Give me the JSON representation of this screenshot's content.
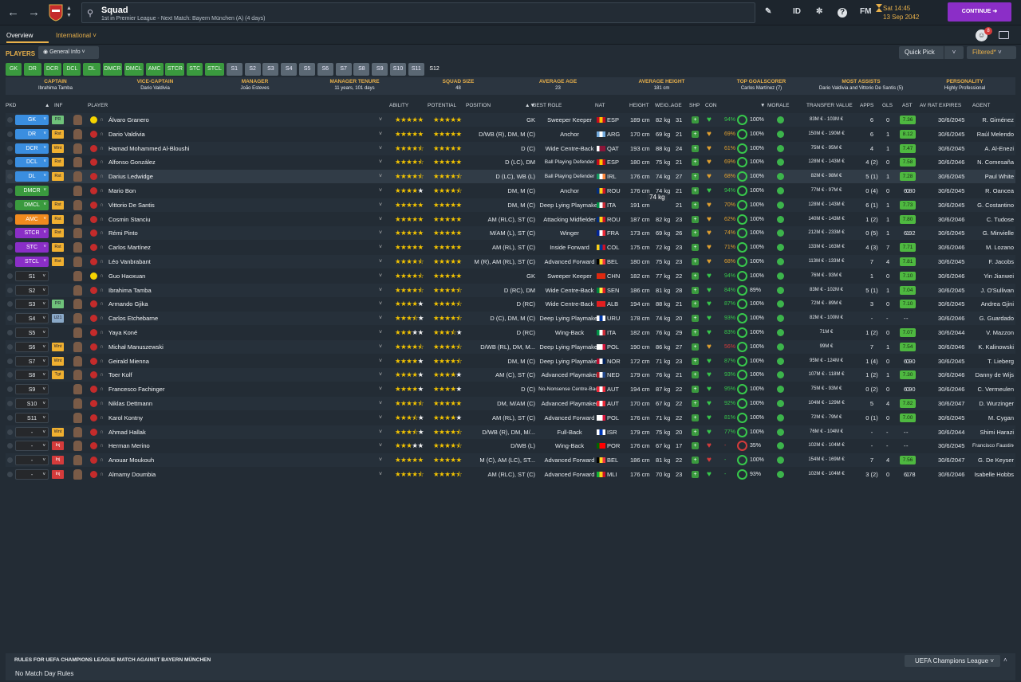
{
  "header": {
    "title": "Squad",
    "subtitle": "1st in Premier League - Next Match: Bayern München (A) (4 days)",
    "id_label": "ID",
    "fm_label": "FM",
    "time": "Sat 14:45",
    "date": "13 Sep 2042",
    "continue_label": "CONTINUE",
    "notification_count": "8"
  },
  "subnav": {
    "overview": "Overview",
    "international": "International"
  },
  "toolbar": {
    "players_label": "PLAYERS",
    "view": "General Info",
    "quick_pick": "Quick Pick",
    "filter": "Filtered*"
  },
  "chips": [
    {
      "label": "GK",
      "c": "g"
    },
    {
      "label": "DR",
      "c": "g"
    },
    {
      "label": "DCR",
      "c": "g"
    },
    {
      "label": "DCL",
      "c": "g"
    },
    {
      "label": "DL",
      "c": "g"
    },
    {
      "label": "DMCR",
      "c": "g"
    },
    {
      "label": "DMCL",
      "c": "g"
    },
    {
      "label": "AMC",
      "c": "g"
    },
    {
      "label": "STCR",
      "c": "g"
    },
    {
      "label": "STC",
      "c": "g"
    },
    {
      "label": "STCL",
      "c": "g"
    },
    {
      "label": "S1",
      "c": "s"
    },
    {
      "label": "S2",
      "c": "s"
    },
    {
      "label": "S3",
      "c": "s"
    },
    {
      "label": "S4",
      "c": "s"
    },
    {
      "label": "S5",
      "c": "s"
    },
    {
      "label": "S6",
      "c": "s"
    },
    {
      "label": "S7",
      "c": "s"
    },
    {
      "label": "S8",
      "c": "s"
    },
    {
      "label": "S9",
      "c": "s"
    },
    {
      "label": "S10",
      "c": "s"
    },
    {
      "label": "S11",
      "c": "s"
    },
    {
      "label": "S12",
      "c": "sel"
    }
  ],
  "stats": [
    {
      "h": "CAPTAIN",
      "v": "Ibrahima Tamba"
    },
    {
      "h": "VICE-CAPTAIN",
      "v": "Dario Valdivia"
    },
    {
      "h": "MANAGER",
      "v": "João Esteves"
    },
    {
      "h": "MANAGER TENURE",
      "v": "11 years, 101 days"
    },
    {
      "h": "SQUAD SIZE",
      "v": "48"
    },
    {
      "h": "AVERAGE AGE",
      "v": "23"
    },
    {
      "h": "AVERAGE HEIGHT",
      "v": "181 cm"
    },
    {
      "h": "TOP GOALSCORER",
      "v": "Carlos Martínez (7)"
    },
    {
      "h": "MOST ASSISTS",
      "v": "Dario Valdivia and Vittorio De Santis (5)"
    },
    {
      "h": "PERSONALITY",
      "v": "Highly Professional"
    }
  ],
  "columns": {
    "pkd": "PKD",
    "inf": "INF",
    "player": "PLAYER",
    "ability": "ABILITY",
    "potential": "POTENTIAL",
    "position": "POSITION",
    "best_role": "BEST ROLE",
    "nat": "NAT",
    "height": "HEIGHT",
    "weight": "WEIG...",
    "age": "AGE",
    "shp": "SHP",
    "con": "CON",
    "morale": "MORALE",
    "value": "TRANSFER VALUE",
    "apps": "APPS",
    "gls": "GLS",
    "ast": "AST",
    "avrat": "AV RAT",
    "expires": "EXPIRES",
    "agent": "AGENT"
  },
  "tooltip": "74 kg",
  "players": [
    {
      "sel": "GK",
      "sc": "#3a8ee0",
      "inf": "PR",
      "ic": "#6fc27a",
      "kit": "y",
      "name": "Álvaro Granero",
      "ab": 5,
      "po": 5,
      "pos": "GK",
      "role": "Sweeper Keeper",
      "nat": "ESP",
      "f": [
        "#c60b1e",
        "#ffc400",
        "#c60b1e"
      ],
      "h": "189 cm",
      "w": "82 kg",
      "age": "31",
      "hc": "#37c74b",
      "cp": "94%",
      "cc": "#37c74b",
      "mo": "100%",
      "val": "83M € - 103M €",
      "apps": "6",
      "gls": "0",
      "ast": "0",
      "rat": "7.36",
      "exp": "30/6/2045",
      "ag": "R. Giménez"
    },
    {
      "sel": "DR",
      "sc": "#3a8ee0",
      "inf": "Rst",
      "ic": "#f0b030",
      "kit": "r",
      "name": "Dario Valdivia",
      "ab": 5,
      "po": 5,
      "pos": "D/WB (R), DM, M (C)",
      "role": "Anchor",
      "nat": "ARG",
      "f": [
        "#74acdf",
        "#fff",
        "#74acdf"
      ],
      "h": "170 cm",
      "w": "69 kg",
      "age": "21",
      "hc": "#e0a030",
      "cp": "69%",
      "cc": "#e0a030",
      "mo": "100%",
      "val": "150M € - 190M €",
      "apps": "6",
      "gls": "1",
      "ast": "5",
      "rat": "8.12",
      "exp": "30/6/2045",
      "ag": "Raúl Melendo"
    },
    {
      "sel": "DCR",
      "sc": "#3a8ee0",
      "inf": "Wnt",
      "ic": "#f0b030",
      "kit": "r",
      "name": "Hamad Mohammed Al-Bloushi",
      "ab": 4.5,
      "po": 5,
      "pos": "D (C)",
      "role": "Wide Centre-Back",
      "nat": "QAT",
      "f": [
        "#fff",
        "#8a1538",
        "#8a1538"
      ],
      "h": "193 cm",
      "w": "88 kg",
      "age": "24",
      "hc": "#e0a030",
      "cp": "61%",
      "cc": "#e0a030",
      "mo": "100%",
      "val": "75M € - 95M €",
      "apps": "4",
      "gls": "1",
      "ast": "0",
      "rat": "7.47",
      "exp": "30/6/2045",
      "ag": "A. Al-Enezi"
    },
    {
      "sel": "DCL",
      "sc": "#3a8ee0",
      "inf": "Rst",
      "ic": "#f0b030",
      "kit": "r",
      "name": "Alfonso González",
      "ab": 4.5,
      "po": 5,
      "pos": "D (LC), DM",
      "role": "Ball Playing Defender",
      "nat": "ESP",
      "f": [
        "#c60b1e",
        "#ffc400",
        "#c60b1e"
      ],
      "h": "180 cm",
      "w": "75 kg",
      "age": "21",
      "hc": "#e0a030",
      "cp": "69%",
      "cc": "#e0a030",
      "mo": "100%",
      "val": "128M € - 143M €",
      "apps": "4 (2)",
      "gls": "0",
      "ast": "2",
      "rat": "7.58",
      "exp": "30/6/2046",
      "ag": "N. Comesaña"
    },
    {
      "sel": "DL",
      "sc": "#3a8ee0",
      "inf": "Rst",
      "ic": "#f0b030",
      "kit": "r",
      "name": "Darius Ledwidge",
      "ab": 4.5,
      "po": 4.5,
      "pos": "D (LC), WB (L)",
      "role": "Ball Playing Defender",
      "nat": "IRL",
      "f": [
        "#169b62",
        "#fff",
        "#ff883e"
      ],
      "h": "176 cm",
      "w": "74 kg",
      "age": "27",
      "hc": "#e0a030",
      "cp": "68%",
      "cc": "#e0a030",
      "mo": "100%",
      "val": "82M € - 98M €",
      "apps": "5 (1)",
      "gls": "1",
      "ast": "1",
      "rat": "7.28",
      "exp": "30/6/2045",
      "ag": "Paul White",
      "hl": true
    },
    {
      "sel": "DMCR",
      "sc": "#3a9a3e",
      "inf": "",
      "ic": "",
      "kit": "r",
      "name": "Mario Bon",
      "ab": 4,
      "po": 4.5,
      "pos": "DM, M (C)",
      "role": "Anchor",
      "nat": "ROU",
      "f": [
        "#002b7f",
        "#fcd116",
        "#ce1126"
      ],
      "h": "176 cm",
      "w": "74 kg",
      "age": "21",
      "hc": "#37c74b",
      "cp": "94%",
      "cc": "#37c74b",
      "mo": "100%",
      "val": "77M € - 97M €",
      "apps": "0 (4)",
      "gls": "0",
      "ast": "0",
      "rat": "6.80",
      "exp": "30/6/2045",
      "ag": "R. Oancea"
    },
    {
      "sel": "DMCL",
      "sc": "#3a9a3e",
      "inf": "Rst",
      "ic": "#f0b030",
      "kit": "r",
      "name": "Vittorio De Santis",
      "ab": 5,
      "po": 5,
      "pos": "DM, M (C)",
      "role": "Deep Lying Playmaker",
      "nat": "ITA",
      "f": [
        "#009246",
        "#fff",
        "#ce2b37"
      ],
      "h": "191 cm",
      "w": "",
      "age": "21",
      "hc": "#e0a030",
      "cp": "70%",
      "cc": "#e0a030",
      "mo": "100%",
      "val": "128M € - 143M €",
      "apps": "6 (1)",
      "gls": "1",
      "ast": "5",
      "rat": "7.73",
      "exp": "30/6/2045",
      "ag": "G. Costantino"
    },
    {
      "sel": "AMC",
      "sc": "#f08a1e",
      "inf": "Rst",
      "ic": "#f0b030",
      "kit": "r",
      "name": "Cosmin Stanciu",
      "ab": 5,
      "po": 5,
      "pos": "AM (RLC), ST (C)",
      "role": "Attacking Midfielder",
      "nat": "ROU",
      "f": [
        "#002b7f",
        "#fcd116",
        "#ce1126"
      ],
      "h": "187 cm",
      "w": "82 kg",
      "age": "23",
      "hc": "#e0a030",
      "cp": "62%",
      "cc": "#e0a030",
      "mo": "100%",
      "val": "140M € - 143M €",
      "apps": "1 (2)",
      "gls": "1",
      "ast": "1",
      "rat": "7.80",
      "exp": "30/6/2046",
      "ag": "C. Tudose"
    },
    {
      "sel": "STCR",
      "sc": "#8a2ec7",
      "inf": "Rst",
      "ic": "#f0b030",
      "kit": "r",
      "name": "Rémi Pinto",
      "ab": 5,
      "po": 5,
      "pos": "M/AM (L), ST (C)",
      "role": "Winger",
      "nat": "FRA",
      "f": [
        "#002395",
        "#fff",
        "#ed2939"
      ],
      "h": "173 cm",
      "w": "69 kg",
      "age": "26",
      "hc": "#e0a030",
      "cp": "74%",
      "cc": "#e0a030",
      "mo": "100%",
      "val": "212M € - 233M €",
      "apps": "0 (5)",
      "gls": "1",
      "ast": "1",
      "rat": "6.92",
      "exp": "30/6/2045",
      "ag": "G. Minvielle"
    },
    {
      "sel": "STC",
      "sc": "#8a2ec7",
      "inf": "Rst",
      "ic": "#f0b030",
      "kit": "r",
      "name": "Carlos Martínez",
      "ab": 5,
      "po": 5,
      "pos": "AM (RL), ST (C)",
      "role": "Inside Forward",
      "nat": "COL",
      "f": [
        "#fcd116",
        "#003893",
        "#ce1126"
      ],
      "h": "175 cm",
      "w": "72 kg",
      "age": "23",
      "hc": "#e0a030",
      "cp": "71%",
      "cc": "#e0a030",
      "mo": "100%",
      "val": "133M € - 163M €",
      "apps": "4 (3)",
      "gls": "7",
      "ast": "2",
      "rat": "7.71",
      "exp": "30/6/2046",
      "ag": "M. Lozano"
    },
    {
      "sel": "STCL",
      "sc": "#8a2ec7",
      "inf": "Rst",
      "ic": "#f0b030",
      "kit": "r",
      "name": "Léo Vanbrabant",
      "ab": 4.5,
      "po": 5,
      "pos": "M (R), AM (RL), ST (C)",
      "role": "Advanced Forward",
      "nat": "BEL",
      "f": [
        "#000",
        "#fdda24",
        "#ef3340"
      ],
      "h": "180 cm",
      "w": "75 kg",
      "age": "23",
      "hc": "#e0a030",
      "cp": "68%",
      "cc": "#e0a030",
      "mo": "100%",
      "val": "113M € - 133M €",
      "apps": "7",
      "gls": "4",
      "ast": "3",
      "rat": "7.81",
      "exp": "30/6/2045",
      "ag": "F. Jacobs"
    },
    {
      "sel": "S1",
      "sc": "",
      "inf": "",
      "ic": "",
      "kit": "y",
      "name": "Guo Haoxuan",
      "ab": 4.5,
      "po": 5,
      "pos": "GK",
      "role": "Sweeper Keeper",
      "nat": "CHN",
      "f": [
        "#de2910",
        "#de2910",
        "#de2910"
      ],
      "h": "182 cm",
      "w": "77 kg",
      "age": "22",
      "hc": "#37c74b",
      "cp": "94%",
      "cc": "#37c74b",
      "mo": "100%",
      "val": "76M € - 93M €",
      "apps": "1",
      "gls": "0",
      "ast": "0",
      "rat": "7.10",
      "exp": "30/6/2046",
      "ag": "Yin Jianwei"
    },
    {
      "sel": "S2",
      "sc": "",
      "inf": "",
      "ic": "",
      "kit": "r",
      "name": "Ibrahima Tamba",
      "ab": 4.5,
      "po": 4.5,
      "pos": "D (RC), DM",
      "role": "Wide Centre-Back",
      "nat": "SEN",
      "f": [
        "#00853f",
        "#fdef42",
        "#e31b23"
      ],
      "h": "186 cm",
      "w": "81 kg",
      "age": "28",
      "hc": "#37c74b",
      "cp": "84%",
      "cc": "#37c74b",
      "mo": "89%",
      "val": "83M € - 102M €",
      "apps": "5 (1)",
      "gls": "1",
      "ast": "0",
      "rat": "7.04",
      "exp": "30/6/2045",
      "ag": "J. O'Sullivan"
    },
    {
      "sel": "S3",
      "sc": "",
      "inf": "PR",
      "ic": "#6fc27a",
      "kit": "r",
      "name": "Armando Gjika",
      "ab": 4,
      "po": 4.5,
      "pos": "D (RC)",
      "role": "Wide Centre-Back",
      "nat": "ALB",
      "f": [
        "#e41e20",
        "#e41e20",
        "#e41e20"
      ],
      "h": "194 cm",
      "w": "88 kg",
      "age": "21",
      "hc": "#37c74b",
      "cp": "87%",
      "cc": "#37c74b",
      "mo": "100%",
      "val": "72M € - 89M €",
      "apps": "3",
      "gls": "0",
      "ast": "0",
      "rat": "7.10",
      "exp": "30/6/2045",
      "ag": "Andrea Gjini"
    },
    {
      "sel": "S4",
      "sc": "",
      "inf": "U21",
      "ic": "#8aa9c8",
      "kit": "r",
      "name": "Carlos Etchebarne",
      "ab": 3.5,
      "po": 4.5,
      "pos": "D (C), DM, M (C)",
      "role": "Deep Lying Playmaker",
      "nat": "URU",
      "f": [
        "#fff",
        "#0038a8",
        "#fff"
      ],
      "h": "178 cm",
      "w": "74 kg",
      "age": "20",
      "hc": "#37c74b",
      "cp": "93%",
      "cc": "#37c74b",
      "mo": "100%",
      "val": "82M € - 100M €",
      "apps": "-",
      "gls": "-",
      "ast": "-",
      "rat": "-",
      "exp": "30/6/2046",
      "ag": "G. Guardado"
    },
    {
      "sel": "S5",
      "sc": "",
      "inf": "",
      "ic": "",
      "kit": "r",
      "name": "Yaya Koné",
      "ab": 3,
      "po": 3.5,
      "pos": "D (RC)",
      "role": "Wing-Back",
      "nat": "ITA",
      "f": [
        "#009246",
        "#fff",
        "#ce2b37"
      ],
      "h": "182 cm",
      "w": "76 kg",
      "age": "29",
      "hc": "#37c74b",
      "cp": "83%",
      "cc": "#37c74b",
      "mo": "100%",
      "val": "71M €",
      "apps": "1 (2)",
      "gls": "0",
      "ast": "0",
      "rat": "7.07",
      "exp": "30/6/2044",
      "ag": "V. Mazzon"
    },
    {
      "sel": "S6",
      "sc": "",
      "inf": "Wnt",
      "ic": "#f0b030",
      "kit": "r",
      "name": "Michał Manuszewski",
      "ab": 4.5,
      "po": 4.5,
      "pos": "D/WB (RL), DM, M...",
      "role": "Deep Lying Playmaker",
      "nat": "POL",
      "f": [
        "#fff",
        "#fff",
        "#dc143c"
      ],
      "h": "190 cm",
      "w": "86 kg",
      "age": "27",
      "hc": "#e0a030",
      "cp": "56%",
      "cc": "#d43b3b",
      "mo": "100%",
      "val": "99M €",
      "apps": "7",
      "gls": "1",
      "ast": "3",
      "rat": "7.54",
      "exp": "30/6/2046",
      "ag": "K. Kalinowski"
    },
    {
      "sel": "S7",
      "sc": "",
      "inf": "Wnt",
      "ic": "#f0b030",
      "kit": "r",
      "name": "Geirald Mienna",
      "ab": 4,
      "po": 4.5,
      "pos": "DM, M (C)",
      "role": "Deep Lying Playmaker",
      "nat": "NOR",
      "f": [
        "#ba0c2f",
        "#fff",
        "#00205b"
      ],
      "h": "172 cm",
      "w": "71 kg",
      "age": "23",
      "hc": "#37c74b",
      "cp": "87%",
      "cc": "#37c74b",
      "mo": "100%",
      "val": "95M € - 124M €",
      "apps": "1 (4)",
      "gls": "0",
      "ast": "0",
      "rat": "6.90",
      "exp": "30/6/2045",
      "ag": "T. Lieberg"
    },
    {
      "sel": "S8",
      "sc": "",
      "inf": "Tgt",
      "ic": "#f0b030",
      "kit": "r",
      "name": "Toer Kolf",
      "ab": 4,
      "po": 4,
      "pos": "AM (C), ST (C)",
      "role": "Advanced Playmaker",
      "nat": "NED",
      "f": [
        "#ae1c28",
        "#fff",
        "#21468b"
      ],
      "h": "179 cm",
      "w": "76 kg",
      "age": "21",
      "hc": "#37c74b",
      "cp": "93%",
      "cc": "#37c74b",
      "mo": "100%",
      "val": "107M € - 118M €",
      "apps": "1 (2)",
      "gls": "1",
      "ast": "0",
      "rat": "7.30",
      "exp": "30/6/2046",
      "ag": "Danny de Wijs"
    },
    {
      "sel": "S9",
      "sc": "",
      "inf": "",
      "ic": "",
      "kit": "r",
      "name": "Francesco Fachinger",
      "ab": 4,
      "po": 4,
      "pos": "D (C)",
      "role": "No-Nonsense Centre-Back",
      "nat": "AUT",
      "f": [
        "#ed2939",
        "#fff",
        "#ed2939"
      ],
      "h": "194 cm",
      "w": "87 kg",
      "age": "22",
      "hc": "#37c74b",
      "cp": "95%",
      "cc": "#37c74b",
      "mo": "100%",
      "val": "75M € - 93M €",
      "apps": "0 (2)",
      "gls": "0",
      "ast": "0",
      "rat": "6.90",
      "exp": "30/6/2046",
      "ag": "C. Vermeulen"
    },
    {
      "sel": "S10",
      "sc": "",
      "inf": "",
      "ic": "",
      "kit": "r",
      "name": "Niklas Dettmann",
      "ab": 4.5,
      "po": 5,
      "pos": "DM, M/AM (C)",
      "role": "Advanced Playmaker",
      "nat": "AUT",
      "f": [
        "#ed2939",
        "#fff",
        "#ed2939"
      ],
      "h": "170 cm",
      "w": "67 kg",
      "age": "22",
      "hc": "#37c74b",
      "cp": "92%",
      "cc": "#37c74b",
      "mo": "100%",
      "val": "104M € - 129M €",
      "apps": "5",
      "gls": "4",
      "ast": "0",
      "rat": "7.82",
      "exp": "30/6/2047",
      "ag": "D. Wurzinger"
    },
    {
      "sel": "S11",
      "sc": "",
      "inf": "",
      "ic": "",
      "kit": "r",
      "name": "Karol Kontny",
      "ab": 3.5,
      "po": 4,
      "pos": "AM (RL), ST (C)",
      "role": "Advanced Forward",
      "nat": "POL",
      "f": [
        "#fff",
        "#fff",
        "#dc143c"
      ],
      "h": "176 cm",
      "w": "71 kg",
      "age": "22",
      "hc": "#37c74b",
      "cp": "81%",
      "cc": "#37c74b",
      "mo": "100%",
      "val": "72M € - 79M €",
      "apps": "0 (1)",
      "gls": "0",
      "ast": "0",
      "rat": "7.00",
      "exp": "30/6/2045",
      "ag": "M. Cygan"
    },
    {
      "sel": "-",
      "sc": "",
      "inf": "Wnt",
      "ic": "#f0b030",
      "kit": "r",
      "name": "Ahmad Hallak",
      "ab": 3.5,
      "po": 4.5,
      "pos": "D/WB (R), DM, M/...",
      "role": "Full-Back",
      "nat": "ISR",
      "f": [
        "#fff",
        "#0038b8",
        "#fff"
      ],
      "h": "179 cm",
      "w": "75 kg",
      "age": "20",
      "hc": "#37c74b",
      "cp": "77%",
      "cc": "#37c74b",
      "mo": "100%",
      "val": "76M € - 104M €",
      "apps": "-",
      "gls": "-",
      "ast": "-",
      "rat": "-",
      "exp": "30/6/2044",
      "ag": "Shimi Harazi"
    },
    {
      "sel": "-",
      "sc": "",
      "inf": "Inj",
      "ic": "#d43b3b",
      "kit": "r",
      "name": "Herman Merino",
      "ab": 3,
      "po": 4.5,
      "pos": "D/WB (L)",
      "role": "Wing-Back",
      "nat": "POR",
      "f": [
        "#006600",
        "#ff0000",
        "#ff0000"
      ],
      "h": "176 cm",
      "w": "67 kg",
      "age": "17",
      "hc": "#d43b3b",
      "cp": "-",
      "cc": "#d43b3b",
      "mo": "35%",
      "val": "102M € - 104M €",
      "apps": "-",
      "gls": "-",
      "ast": "-",
      "rat": "-",
      "exp": "30/6/2045",
      "ag": "Francisco Faustino"
    },
    {
      "sel": "-",
      "sc": "",
      "inf": "Inj",
      "ic": "#d43b3b",
      "kit": "r",
      "name": "Anouar Moukouh",
      "ab": 5,
      "po": 5,
      "pos": "M (C), AM (LC), ST...",
      "role": "Advanced Forward",
      "nat": "BEL",
      "f": [
        "#000",
        "#fdda24",
        "#ef3340"
      ],
      "h": "186 cm",
      "w": "81 kg",
      "age": "22",
      "hc": "#d43b3b",
      "cp": "-",
      "cc": "#37c74b",
      "mo": "100%",
      "val": "154M € - 169M €",
      "apps": "7",
      "gls": "4",
      "ast": "0",
      "rat": "7.56",
      "exp": "30/6/2047",
      "ag": "G. De Keyser"
    },
    {
      "sel": "-",
      "sc": "",
      "inf": "Inj",
      "ic": "#d43b3b",
      "kit": "r",
      "name": "Almamy Doumbia",
      "ab": 4.5,
      "po": 4.5,
      "pos": "AM (RLC), ST (C)",
      "role": "Advanced Forward",
      "nat": "MLI",
      "f": [
        "#14b53a",
        "#fcd116",
        "#ce1126"
      ],
      "h": "176 cm",
      "w": "70 kg",
      "age": "23",
      "hc": "#37c74b",
      "cp": "-",
      "cc": "#37c74b",
      "mo": "93%",
      "val": "102M € - 104M €",
      "apps": "3 (2)",
      "gls": "0",
      "ast": "1",
      "rat": "6.78",
      "exp": "30/6/2046",
      "ag": "Isabelle Hobbs"
    }
  ],
  "bottom": {
    "title": "RULES FOR UEFA CHAMPIONS LEAGUE MATCH AGAINST BAYERN MÜNCHEN",
    "value": "No Match Day Rules",
    "competition": "UEFA Champions League"
  }
}
